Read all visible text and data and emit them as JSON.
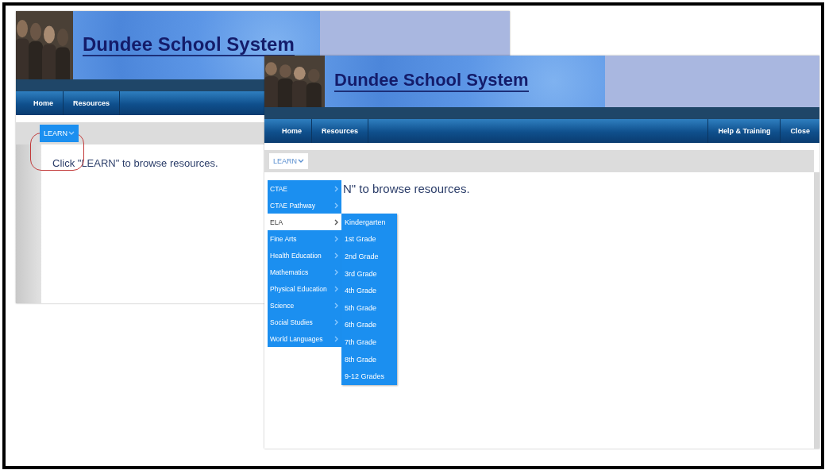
{
  "screenshots": [
    {
      "banner": {
        "title": "Dundee School System"
      },
      "nav_left": [
        {
          "label": "Home"
        },
        {
          "label": "Resources"
        }
      ],
      "learn_button": {
        "label": "LEARN",
        "kind": "filled",
        "highlighted": true
      },
      "message": "Click \"LEARN\" to browse resources."
    },
    {
      "banner": {
        "title": "Dundee School System"
      },
      "nav_left": [
        {
          "label": "Home"
        },
        {
          "label": "Resources"
        }
      ],
      "nav_right": [
        {
          "label": "Help & Training"
        },
        {
          "label": "Close"
        }
      ],
      "learn_button": {
        "label": "LEARN",
        "kind": "plain",
        "highlighted": false
      },
      "message": "N\" to browse resources.",
      "menu": {
        "items": [
          {
            "label": "CTAE",
            "selected": false
          },
          {
            "label": "CTAE Pathway",
            "selected": false
          },
          {
            "label": "ELA",
            "selected": true
          },
          {
            "label": "Fine Arts",
            "selected": false
          },
          {
            "label": "Health Education",
            "selected": false
          },
          {
            "label": "Mathematics",
            "selected": false
          },
          {
            "label": "Physical Education",
            "selected": false
          },
          {
            "label": "Science",
            "selected": false
          },
          {
            "label": "Social Studies",
            "selected": false
          },
          {
            "label": "World Languages",
            "selected": false
          }
        ],
        "submenu": [
          {
            "label": "Kindergarten"
          },
          {
            "label": "1st Grade"
          },
          {
            "label": "2nd Grade"
          },
          {
            "label": "3rd Grade"
          },
          {
            "label": "4th Grade"
          },
          {
            "label": "5th Grade"
          },
          {
            "label": "6th Grade"
          },
          {
            "label": "7th Grade"
          },
          {
            "label": "8th Grade"
          },
          {
            "label": "9-12 Grades"
          }
        ]
      }
    }
  ]
}
